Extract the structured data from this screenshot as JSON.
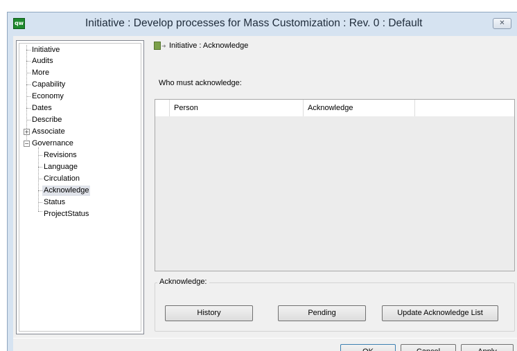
{
  "window": {
    "title": "Initiative : Develop processes for Mass Customization : Rev. 0  : Default",
    "app_icon_text": "qw"
  },
  "tree": {
    "items": [
      {
        "label": "Initiative"
      },
      {
        "label": "Audits"
      },
      {
        "label": "More"
      },
      {
        "label": "Capability"
      },
      {
        "label": "Economy"
      },
      {
        "label": "Dates"
      },
      {
        "label": "Describe"
      },
      {
        "label": "Associate",
        "expander": "+"
      },
      {
        "label": "Governance",
        "expander": "−"
      },
      {
        "label": "Revisions"
      },
      {
        "label": "Language"
      },
      {
        "label": "Circulation"
      },
      {
        "label": "Acknowledge",
        "selected": true
      },
      {
        "label": "Status"
      },
      {
        "label": "ProjectStatus"
      }
    ]
  },
  "panel": {
    "title": "Initiative : Acknowledge",
    "who_label": "Who must acknowledge:",
    "grid": {
      "columns": [
        "Person",
        "Acknowledge"
      ],
      "rows": []
    },
    "group": {
      "label": "Acknowledge:",
      "buttons": {
        "history": "History",
        "pending": "Pending",
        "update": "Update Acknowledge List"
      }
    }
  },
  "footer": {
    "ok": "OK",
    "cancel": "Cancel",
    "apply": "Apply"
  },
  "colors": {
    "title_bar": "#d6e3f1",
    "selection": "#e0e3ea",
    "icon_green": "#1f8a2e"
  }
}
